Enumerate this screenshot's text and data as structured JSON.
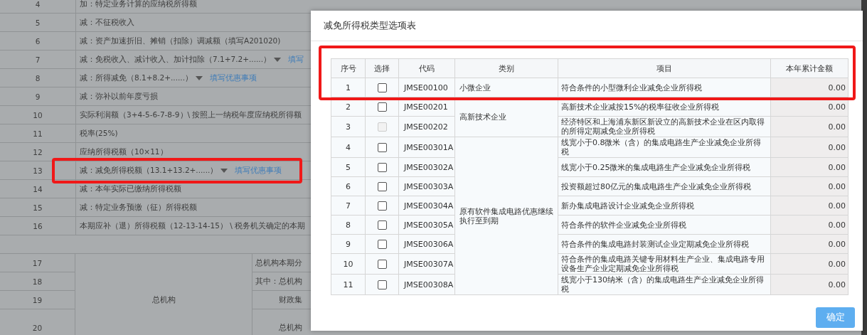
{
  "background_form": {
    "rows": [
      {
        "number": "4",
        "text": "加：特定业务计算的应纳税所得额",
        "dropdown": false
      },
      {
        "number": "5",
        "text": "减：不征税收入",
        "dropdown": false
      },
      {
        "number": "6",
        "text": "减：资产加速折旧、摊销（扣除）调减额（填写A201020)",
        "dropdown": false
      },
      {
        "number": "7",
        "text": "减：免税收入、减计收入、加计扣除（7.1+7.2+......）",
        "dropdown": true,
        "link": "填写"
      },
      {
        "number": "8",
        "text": "减：所得减免（8.1+8.2+......）",
        "dropdown": true,
        "link": "填写优惠事项"
      },
      {
        "number": "9",
        "text": "减：弥补以前年度亏损",
        "dropdown": false
      },
      {
        "number": "10",
        "text": "实际利润额（3+4-5-6-7-8-9）\\ 按照上一纳税年度应纳税所得额",
        "dropdown": false
      },
      {
        "number": "11",
        "text": "税率(25%)",
        "dropdown": false
      },
      {
        "number": "12",
        "text": "应纳所得税额（10×11）",
        "dropdown": false
      },
      {
        "number": "13",
        "text": "减：减免所得税额（13.1+13.2+......）",
        "dropdown": true,
        "link": "填写优惠事项"
      },
      {
        "number": "14",
        "text": "减：本年实际已缴纳所得税额",
        "dropdown": false
      },
      {
        "number": "15",
        "text": "减：特定业务预缴（征）所得税额",
        "dropdown": false
      },
      {
        "number": "16",
        "text": "本期应补（退）所得税额（12-13-14-15） \\ 税务机关确定的本期",
        "dropdown": false
      }
    ],
    "branch_label": "总机构",
    "branch_rows": [
      {
        "number": "17",
        "text": "总机构本期分"
      },
      {
        "number": "18",
        "text": "其中：总机构",
        "children": [
          {
            "number": "19",
            "text": "财政集"
          },
          {
            "number": "20",
            "text": "总机构"
          }
        ]
      }
    ]
  },
  "dialog": {
    "title": "减免所得税类型选项表",
    "columns": [
      "序号",
      "选择",
      "代码",
      "类别",
      "项目",
      "本年累计金额"
    ],
    "groups": [
      {
        "category": "小微企业",
        "rows": [
          {
            "seq": "1",
            "checked": false,
            "disabled": false,
            "code": "JMSE00100",
            "item": "符合条件的小型微利企业减免企业所得税",
            "amount": "0.00"
          }
        ]
      },
      {
        "category": "高新技术企业",
        "rows": [
          {
            "seq": "2",
            "checked": false,
            "disabled": false,
            "code": "JMSE00201",
            "item": "高新技术企业减按15%的税率征收企业所得税",
            "amount": "0.00"
          },
          {
            "seq": "3",
            "checked": false,
            "disabled": true,
            "code": "JMSE00202",
            "item": "经济特区和上海浦东新区新设立的高新技术企业在区内取得的所得定期减免企业所得税",
            "amount": "0.00"
          }
        ]
      },
      {
        "category": "原有软件集成电路优惠继续执行至到期",
        "rows": [
          {
            "seq": "4",
            "checked": false,
            "disabled": false,
            "code": "JMSE00301A",
            "item": "线宽小于0.8微米（含）的集成电路生产企业减免企业所得税",
            "amount": "0.00"
          },
          {
            "seq": "5",
            "checked": false,
            "disabled": false,
            "code": "JMSE00302A",
            "item": "线宽小于0.25微米的集成电路生产企业减免企业所得税",
            "amount": "0.00"
          },
          {
            "seq": "6",
            "checked": false,
            "disabled": false,
            "code": "JMSE00303A",
            "item": "投资额超过80亿元的集成电路生产企业减免企业所得税",
            "amount": "0.00"
          },
          {
            "seq": "7",
            "checked": false,
            "disabled": false,
            "code": "JMSE00304A",
            "item": "新办集成电路设计企业减免企业所得税",
            "amount": "0.00"
          },
          {
            "seq": "8",
            "checked": false,
            "disabled": false,
            "code": "JMSE00305A",
            "item": "符合条件的软件企业减免企业所得税",
            "amount": "0.00"
          },
          {
            "seq": "9",
            "checked": false,
            "disabled": false,
            "code": "JMSE00306A",
            "item": "符合条件的集成电路封装测试企业定期减免企业所得税",
            "amount": "0.00"
          },
          {
            "seq": "10",
            "checked": false,
            "disabled": false,
            "code": "JMSE00307A",
            "item": "符合条件的集成电路关键专用材料生产企业、集成电路专用设备生产企业定期减免企业所得税",
            "amount": "0.00"
          },
          {
            "seq": "11",
            "checked": false,
            "disabled": false,
            "code": "JMSE00308A",
            "item": "线宽小于130纳米（含）的集成电路生产企业减免企业所得税",
            "amount": "0.00"
          }
        ]
      }
    ],
    "confirm_button": "确定"
  }
}
